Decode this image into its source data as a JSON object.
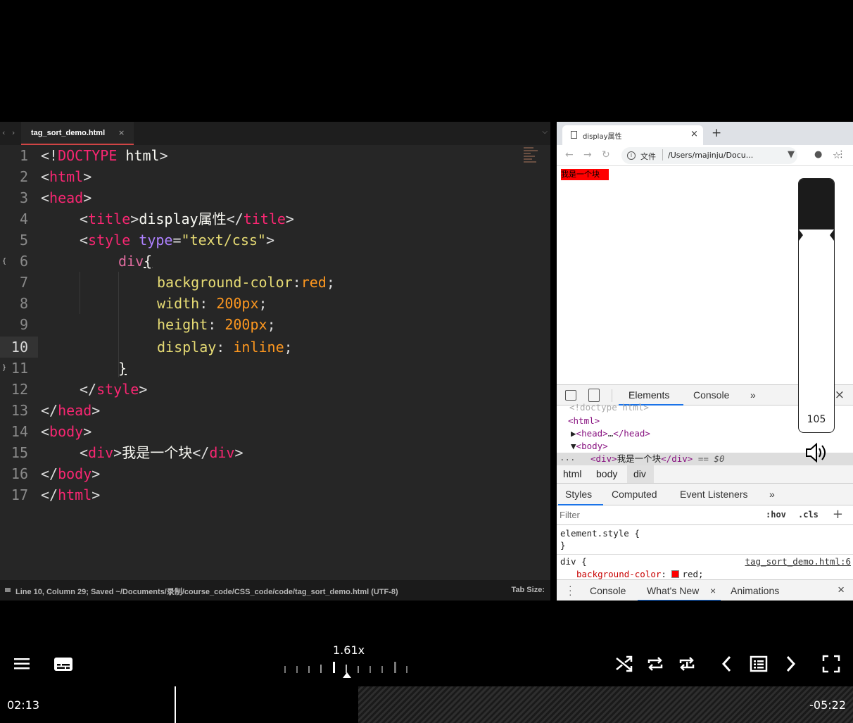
{
  "editor": {
    "tab_title": "tag_sort_demo.html",
    "tab_close": "×",
    "line_numbers": [
      "1",
      "2",
      "3",
      "4",
      "5",
      "6",
      "7",
      "8",
      "9",
      "10",
      "11",
      "12",
      "13",
      "14",
      "15",
      "16",
      "17"
    ],
    "code": {
      "l1": [
        "<!",
        "DOCTYPE",
        " html",
        ">"
      ],
      "l2": [
        "<",
        "html",
        ">"
      ],
      "l3": [
        "<",
        "head",
        ">"
      ],
      "l4": [
        "<",
        "title",
        ">",
        "display属性",
        "</",
        "title",
        ">"
      ],
      "l5": [
        "<",
        "style",
        " type",
        "=",
        "\"text/css\"",
        ">"
      ],
      "l6": [
        "div",
        "{"
      ],
      "l7": [
        "background-color",
        ":",
        "red",
        ";"
      ],
      "l8": [
        "width",
        ": ",
        "200px",
        ";"
      ],
      "l9": [
        "height",
        ": ",
        "200px",
        ";"
      ],
      "l10": [
        "display",
        ": ",
        "inline",
        ";"
      ],
      "l11": [
        "}"
      ],
      "l12": [
        "</",
        "style",
        ">"
      ],
      "l13": [
        "</",
        "head",
        ">"
      ],
      "l14": [
        "<",
        "body",
        ">"
      ],
      "l15": [
        "<",
        "div",
        ">",
        "我是一个块",
        "</",
        "div",
        ">"
      ],
      "l16": [
        "</",
        "body",
        ">"
      ],
      "l17": [
        "</",
        "html",
        ">"
      ]
    },
    "status_text": "Line 10, Column 29; Saved ~/Documents/录制/course_code/CSS_code/code/tag_sort_demo.html (UTF-8)",
    "status_tab": "Tab Size:"
  },
  "browser": {
    "tab_title": "display属性",
    "tab_close": "×",
    "new_tab": "+",
    "url_scheme_label": "文件",
    "url_path": "/Users/majinju/Docu...",
    "page_content": "我是一个块"
  },
  "devtools": {
    "tabs": [
      "Elements",
      "Console",
      "»"
    ],
    "dom": {
      "doctype": "<!doctype html>",
      "html_open": "html",
      "head": "head",
      "head_ellipsis": "…",
      "body": "body",
      "div_tag": "div",
      "div_text": "我是一个块",
      "selected_suffix": "== $0",
      "gutter_dots": "..."
    },
    "breadcrumbs": [
      "html",
      "body",
      "div"
    ],
    "style_tabs": [
      "Styles",
      "Computed",
      "Event Listeners",
      "»"
    ],
    "filter_placeholder": "Filter",
    "filter_hov": ":hov",
    "filter_cls": ".cls",
    "filter_plus": "+",
    "rules": {
      "element_style": "element.style {",
      "close_brace": "}",
      "div_selector": "div {",
      "source": "tag_sort_demo.html:6",
      "prop_name": "background-color",
      "prop_value": "red;"
    },
    "drawer_tabs": [
      "Console",
      "What's New",
      "Animations"
    ],
    "drawer_close": "×"
  },
  "volume": {
    "value": "105"
  },
  "player": {
    "playback_rate": "1.61x",
    "current_time": "02:13",
    "remaining_time": "-05:22",
    "progress_fraction": 0.42
  }
}
